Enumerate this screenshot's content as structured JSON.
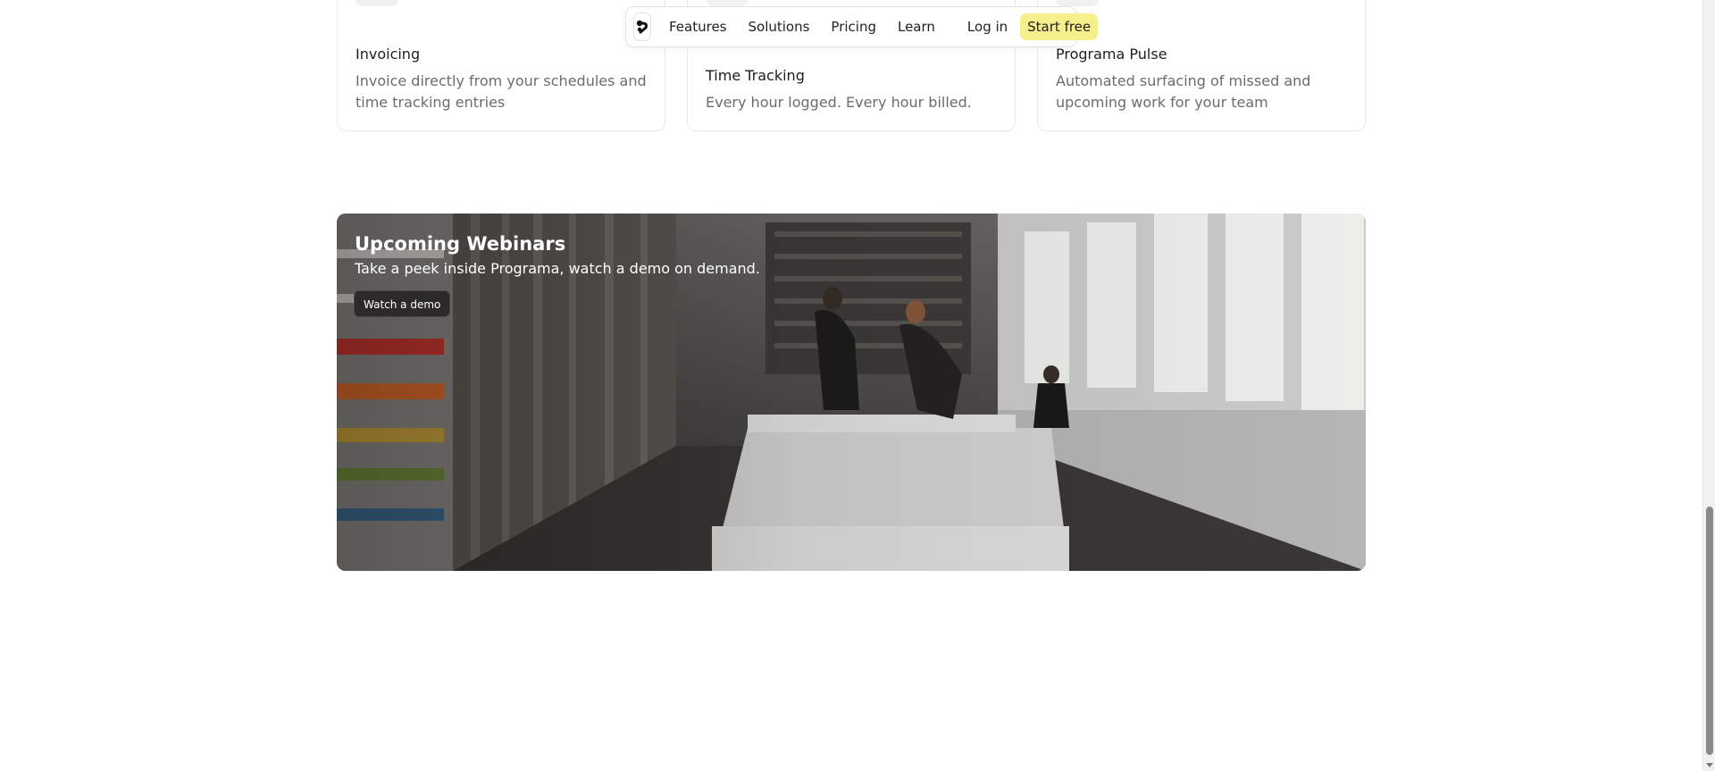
{
  "nav": {
    "links": [
      "Features",
      "Solutions",
      "Pricing",
      "Learn"
    ],
    "login": "Log in",
    "cta": "Start free",
    "cta_color": "#f6ef8c"
  },
  "cards": [
    {
      "icon": "wallet-icon",
      "title": "Invoicing",
      "desc": "Invoice directly from your schedules and time tracking entries"
    },
    {
      "icon": "stopwatch-icon",
      "title": "Time Tracking",
      "desc": "Every hour logged. Every hour billed."
    },
    {
      "icon": "pulse-icon",
      "title": "Programa Pulse",
      "desc": "Automated surfacing of missed and upcoming work for your team"
    }
  ],
  "banner": {
    "title": "Upcoming Webinars",
    "subtitle": "Take a peek inside Programa, watch a demo on demand.",
    "button": "Watch a demo"
  }
}
